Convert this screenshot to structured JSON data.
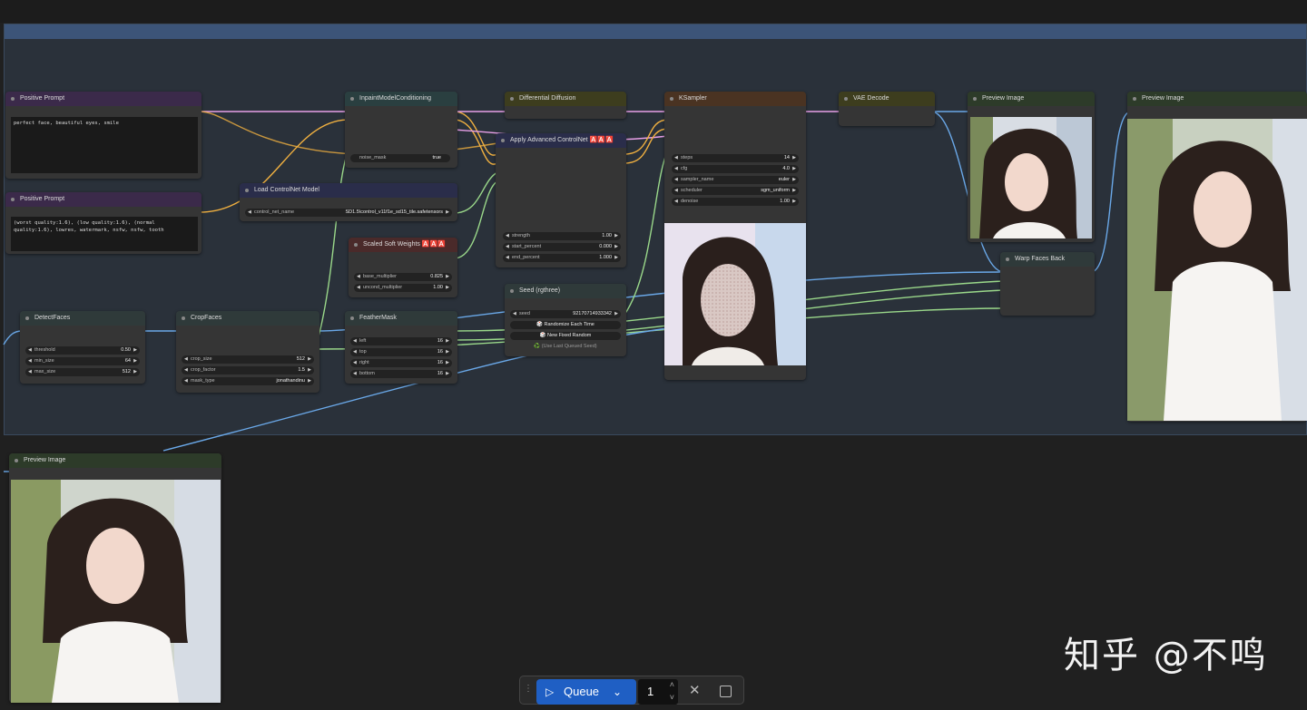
{
  "nodes": {
    "positive_prompt_1": {
      "title": "Positive Prompt",
      "text": "perfect face, beautiful eyes, smile"
    },
    "positive_prompt_2": {
      "title": "Positive Prompt",
      "text": "(worst quality:1.6), (low quality:1.6), (normal quality:1.6), lowres, watermark, nsfw, nsfw, tooth"
    },
    "inpaint_model_conditioning": {
      "title": "InpaintModelConditioning",
      "noise_mask_label": "noise_mask",
      "noise_mask_value": "true"
    },
    "load_controlnet": {
      "title": "Load ControlNet Model",
      "control_net_name_label": "control_net_name",
      "control_net_name_value": "SD1.5\\control_v11f1e_sd15_tile.safetensors"
    },
    "scaled_soft_weights": {
      "title": "Scaled Soft Weights 🅰️🅰️🅰️",
      "base_multiplier_label": "base_multiplier",
      "base_multiplier_value": "0.825",
      "uncond_multiplier_label": "uncond_multiplier",
      "uncond_multiplier_value": "1.00"
    },
    "differential_diffusion": {
      "title": "Differential Diffusion"
    },
    "apply_advanced_controlnet": {
      "title": "Apply Advanced ControlNet 🅰️🅰️🅰️",
      "strength_label": "strength",
      "strength_value": "1.00",
      "start_percent_label": "start_percent",
      "start_percent_value": "0.000",
      "end_percent_label": "end_percent",
      "end_percent_value": "1.000"
    },
    "ksampler": {
      "title": "KSampler",
      "steps_label": "steps",
      "steps_value": "14",
      "cfg_label": "cfg",
      "cfg_value": "4.0",
      "sampler_name_label": "sampler_name",
      "sampler_name_value": "euler",
      "scheduler_label": "scheduler",
      "scheduler_value": "sgm_uniform",
      "denoise_label": "denoise",
      "denoise_value": "1.00"
    },
    "vae_decode": {
      "title": "VAE Decode"
    },
    "preview_image_1": {
      "title": "Preview Image"
    },
    "preview_image_2": {
      "title": "Preview Image"
    },
    "preview_image_3": {
      "title": "Preview Image"
    },
    "warp_faces_back": {
      "title": "Warp Faces Back"
    },
    "seed": {
      "title": "Seed (rgthree)",
      "seed_label": "seed",
      "seed_value": "92170714933342",
      "randomize_label": "🎲 Randomize Each Time",
      "new_fixed_label": "🎲 New Fixed Random",
      "use_last_label": "♻️ (Use Last Queued Seed)"
    },
    "detect_faces": {
      "title": "DetectFaces",
      "threshold_label": "threshold",
      "threshold_value": "0.50",
      "min_size_label": "min_size",
      "min_size_value": "64",
      "max_size_label": "max_size",
      "max_size_value": "512"
    },
    "crop_faces": {
      "title": "CropFaces",
      "crop_size_label": "crop_size",
      "crop_size_value": "512",
      "crop_factor_label": "crop_factor",
      "crop_factor_value": "1.5",
      "mask_type_label": "mask_type",
      "mask_type_value": "jonathandinu"
    },
    "feather_mask": {
      "title": "FeatherMask",
      "left_label": "left",
      "left_value": "16",
      "top_label": "top",
      "top_value": "16",
      "right_label": "right",
      "right_value": "16",
      "bottom_label": "bottom",
      "bottom_value": "16"
    }
  },
  "queue": {
    "label": "Queue",
    "count": "1"
  },
  "watermark": "知乎 @不鸣",
  "colors": {
    "group_header": "#3c5478",
    "queue_button": "#1f5fc4",
    "wire_yellow": "#f0b040",
    "wire_pink": "#e8a0e8",
    "wire_blue": "#6aa8e8",
    "wire_green": "#9ad88a"
  }
}
